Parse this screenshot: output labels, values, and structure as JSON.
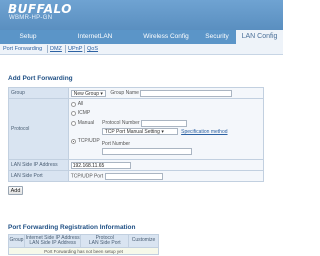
{
  "header": {
    "brand": "BUFFALO",
    "model": "WBMR-HP-GN"
  },
  "tabs": [
    {
      "label": "Setup",
      "active": false
    },
    {
      "label": "InternetLAN",
      "active": false
    },
    {
      "label": "Wireless Config",
      "active": false
    },
    {
      "label": "Security",
      "active": false
    },
    {
      "label": "LAN Config",
      "active": true
    }
  ],
  "subtabs": [
    {
      "label": "Port Forwarding",
      "active": true
    },
    {
      "label": "DMZ",
      "active": false
    },
    {
      "label": "UPnP",
      "active": false
    },
    {
      "label": "QoS",
      "active": false
    }
  ],
  "add_section": {
    "title": "Add Port Forwarding",
    "group_label": "Group",
    "group_select": "New Group",
    "group_name_label": "Group Name",
    "protocol_label": "Protocol",
    "protocol_options": {
      "all": "All",
      "icmp": "ICMP",
      "manual": "Manual",
      "tcp_udp": "TCP/UDP"
    },
    "selected_protocol": "TCP/UDP",
    "protocol_number_label": "Protocol Number",
    "tcp_setting_select": "TCP Port Manual Setting",
    "specification_link": "Specification method",
    "port_number_label": "Port Number",
    "lan_ip_label": "LAN Side IP Address",
    "lan_ip_value": "192.168.11.65",
    "lan_port_label": "LAN Side Port",
    "tcp_udp_port_label": "TCP/UDP Port",
    "add_button": "Add"
  },
  "reg_section": {
    "title": "Port Forwarding Registration Information",
    "columns": [
      "Group",
      "Internet Side IP Address",
      "Protocol LAN Side Port",
      "Customize"
    ],
    "col1": "Group",
    "col2a": "Internet Side IP Address",
    "col2b": "LAN Side IP Address",
    "col3a": "Protocol",
    "col3b": "LAN Side Port",
    "col4": "Customize",
    "empty_message": "Port Forwarding has not been setup yet"
  }
}
